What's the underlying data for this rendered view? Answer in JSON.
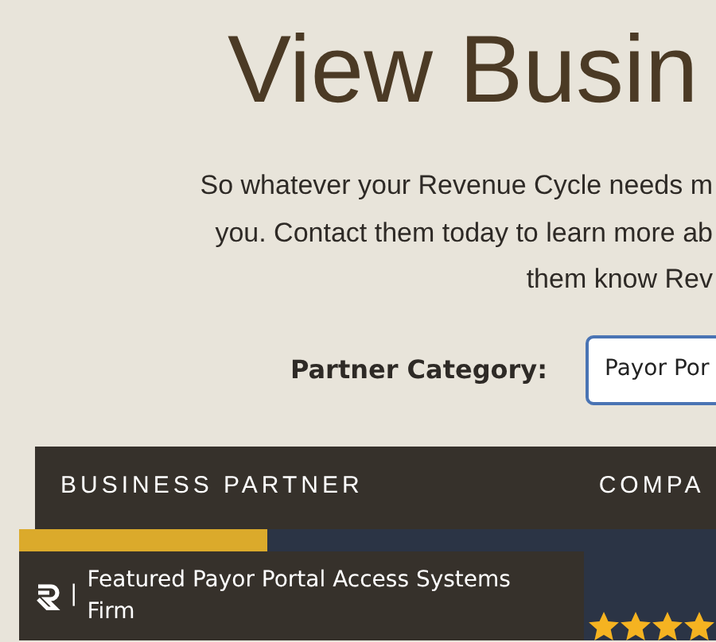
{
  "heading": "View Busin",
  "intro_lines": [
    "So whatever your Revenue Cycle needs m",
    "you. Contact them today to learn more ab",
    "them know Rev"
  ],
  "filter": {
    "label": "Partner Category:",
    "value": "Payor Por"
  },
  "table": {
    "columns": [
      "BUSINESS PARTNER",
      "COMPA"
    ],
    "rows": [
      {
        "separator": "|",
        "badge": "Featured Payor Portal Access Systems Firm",
        "stars": 4
      }
    ]
  }
}
